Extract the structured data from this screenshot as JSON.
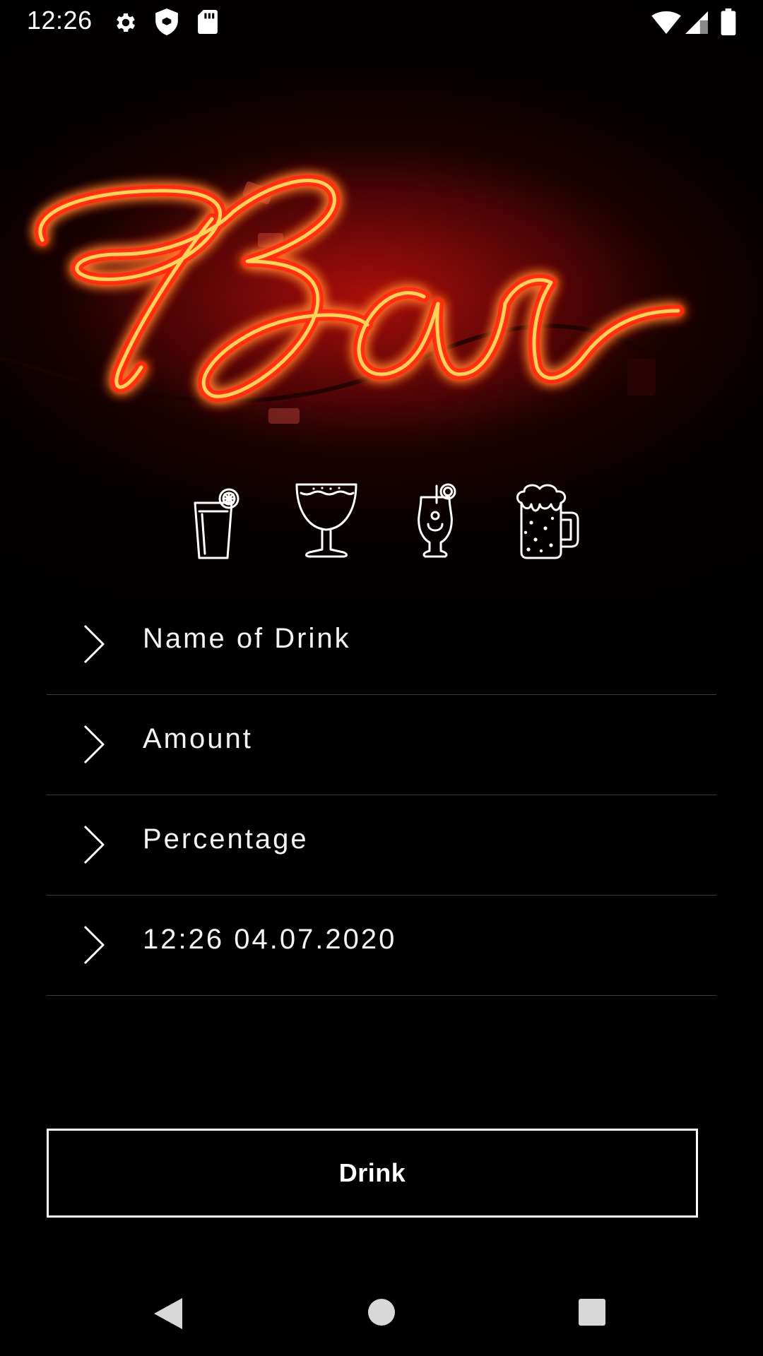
{
  "status_bar": {
    "time": "12:26",
    "left_icons": [
      "gear-icon",
      "shield-icon",
      "sd-card-icon"
    ],
    "right_icons": [
      "wifi-icon",
      "cell-signal-icon",
      "battery-icon"
    ]
  },
  "hero": {
    "neon_sign_text": "Bar",
    "neon_color": "#ff3a1a",
    "glow_color": "#b00c08"
  },
  "drink_types": [
    {
      "icon": "longdrink-glass-icon"
    },
    {
      "icon": "wine-glass-icon"
    },
    {
      "icon": "cocktail-glass-icon"
    },
    {
      "icon": "beer-mug-icon"
    }
  ],
  "form": {
    "fields": [
      {
        "label": "Name of Drink"
      },
      {
        "label": "Amount"
      },
      {
        "label": "Percentage"
      },
      {
        "label": "12:26 04.07.2020"
      }
    ]
  },
  "actions": {
    "drink_label": "Drink"
  },
  "nav_bar": {
    "buttons": [
      "back-icon",
      "home-icon",
      "recents-icon"
    ]
  },
  "colors": {
    "background": "#000000",
    "text": "#ffffff",
    "divider": "#3a3a3a"
  }
}
